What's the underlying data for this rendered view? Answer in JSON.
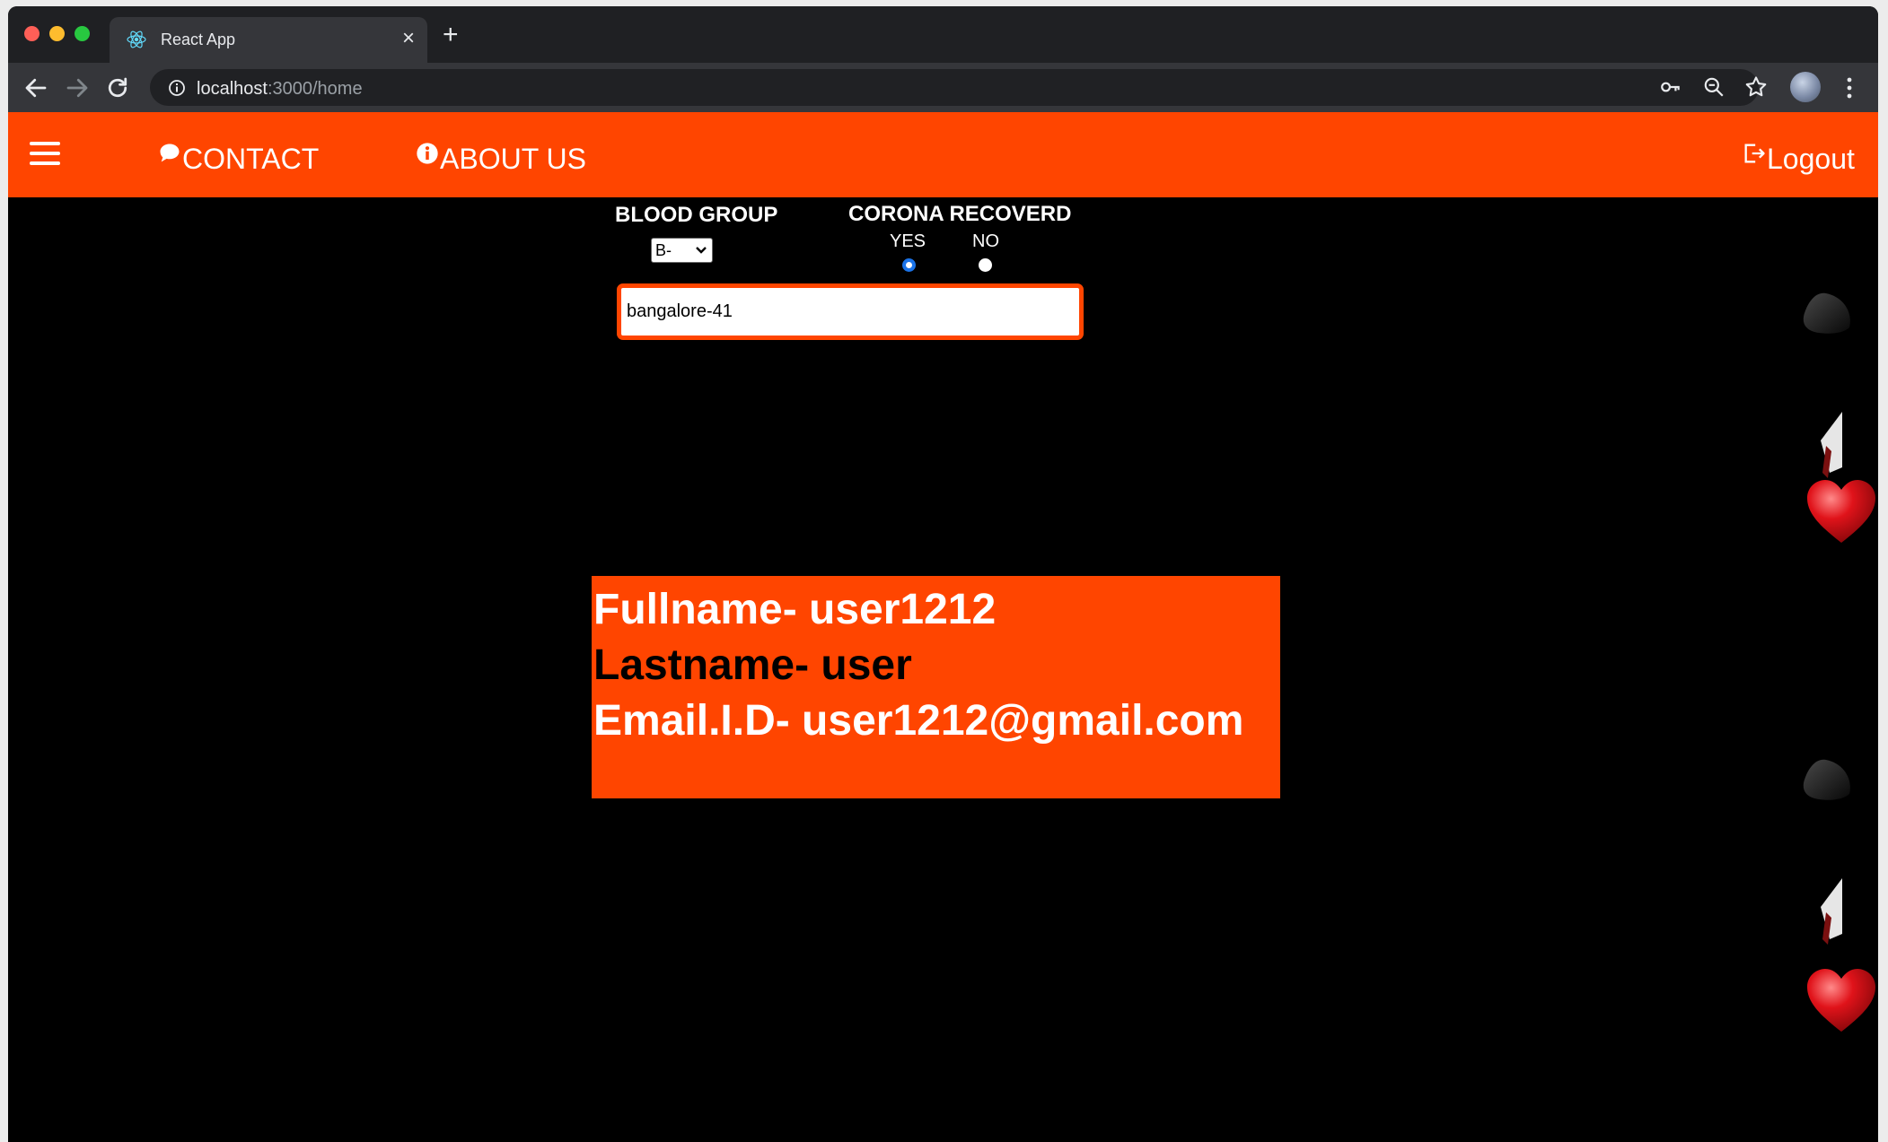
{
  "browser": {
    "tab_title": "React App",
    "tab_close": "×",
    "new_tab": "+",
    "url_host": "localhost",
    "url_rest": ":3000/home"
  },
  "navbar": {
    "contact_label": "CONTACT",
    "about_label": "ABOUT US",
    "logout_label": "Logout"
  },
  "form": {
    "blood_group_label": "BLOOD GROUP",
    "blood_group_value": "B-",
    "corona_label": "CORONA RECOVERD",
    "yes_label": "YES",
    "no_label": "NO",
    "corona_selected": "YES",
    "location_value": "bangalore-41"
  },
  "user": {
    "fullname": "Fullname- user1212",
    "lastname": "Lastname- user",
    "email": "Email.I.D- user1212@gmail.com"
  },
  "colors": {
    "accent": "#ff4500",
    "radio_selected": "#1a73e8",
    "background": "#000000"
  }
}
